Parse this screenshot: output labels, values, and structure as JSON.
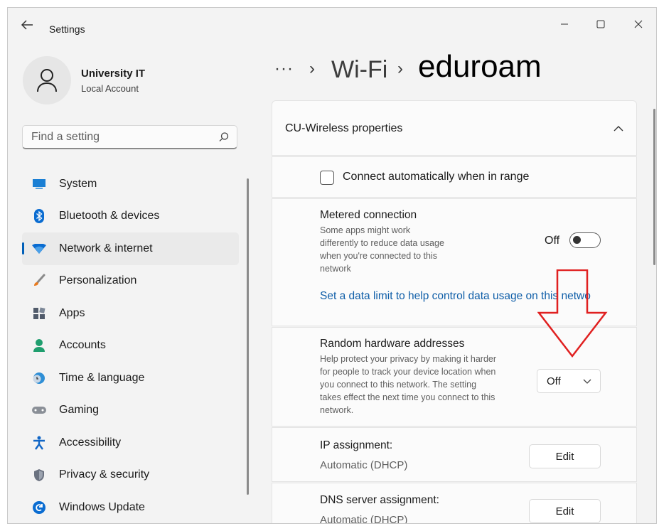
{
  "window": {
    "title": "Settings"
  },
  "user": {
    "name": "University IT",
    "account_type": "Local Account"
  },
  "search": {
    "placeholder": "Find a setting"
  },
  "nav": {
    "items": [
      {
        "label": "System",
        "icon": "monitor-icon"
      },
      {
        "label": "Bluetooth & devices",
        "icon": "bluetooth-icon"
      },
      {
        "label": "Network & internet",
        "icon": "wifi-icon",
        "active": true
      },
      {
        "label": "Personalization",
        "icon": "brush-icon"
      },
      {
        "label": "Apps",
        "icon": "apps-icon"
      },
      {
        "label": "Accounts",
        "icon": "person-icon"
      },
      {
        "label": "Time & language",
        "icon": "globe-clock-icon"
      },
      {
        "label": "Gaming",
        "icon": "gamepad-icon"
      },
      {
        "label": "Accessibility",
        "icon": "accessibility-icon"
      },
      {
        "label": "Privacy & security",
        "icon": "shield-icon"
      },
      {
        "label": "Windows Update",
        "icon": "update-icon"
      }
    ]
  },
  "breadcrumb": {
    "overflow": "···",
    "separator": "›",
    "parent": "Wi-Fi",
    "current": "eduroam"
  },
  "properties": {
    "header": "CU-Wireless properties",
    "connect_auto": {
      "label": "Connect automatically when in range",
      "checked": false
    },
    "metered": {
      "title": "Metered connection",
      "description": [
        "Some apps might work",
        "differently to reduce data usage",
        "when you're connected to this",
        "network"
      ],
      "state_label": "Off",
      "on": false
    },
    "data_limit_link": "Set a data limit to help control data usage on this netwo",
    "random_hw": {
      "title": "Random hardware addresses",
      "description": [
        "Help protect your privacy by making it harder",
        "for people to track your device location when",
        "you connect to this network. The setting",
        "takes effect the next time you connect to this",
        "network."
      ],
      "selected": "Off"
    },
    "ip": {
      "title": "IP assignment:",
      "value": "Automatic (DHCP)",
      "button": "Edit"
    },
    "dns": {
      "title": "DNS server assignment:",
      "value": "Automatic (DHCP)",
      "button": "Edit"
    }
  },
  "colors": {
    "accent": "#005fb8",
    "link": "#0f5ea8",
    "annotation_arrow": "#e02020"
  }
}
